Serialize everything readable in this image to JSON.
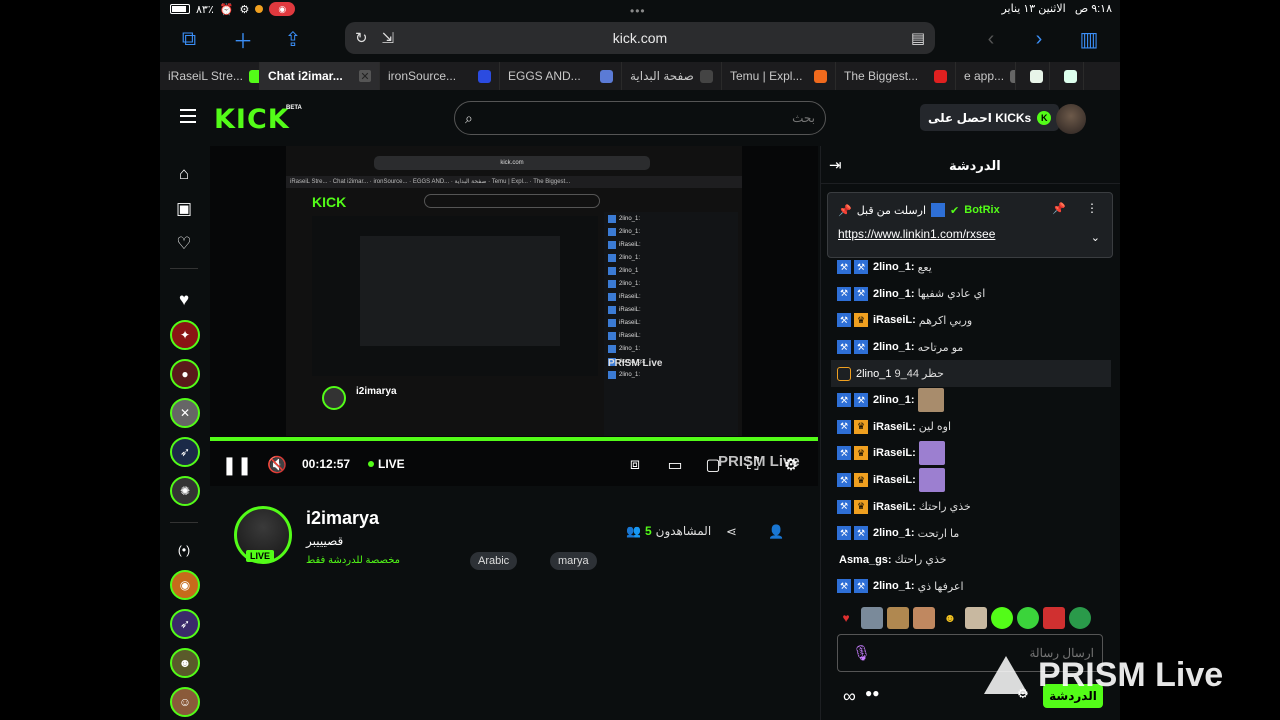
{
  "status_bar": {
    "time": "٩:١٨ ص",
    "date": "الاثنين ١٣ يناير",
    "battery_text": "٨٣٪"
  },
  "browser": {
    "url": "kick.com",
    "tabs": [
      {
        "label": "iRaseiL Stre...",
        "favicon_color": "#53fc18",
        "active": false
      },
      {
        "label": "Chat i2imar...",
        "favicon_color": "#555555",
        "active": true
      },
      {
        "label": "ironSource...",
        "favicon_color": "#2b4be0",
        "active": false
      },
      {
        "label": "EGGS AND...",
        "favicon_color": "#5b7bd6",
        "active": false
      },
      {
        "label": "صفحة البداية",
        "favicon_color": "#444444",
        "active": false
      },
      {
        "label": "Temu | Expl...",
        "favicon_color": "#f06a1d",
        "active": false
      },
      {
        "label": "The Biggest...",
        "favicon_color": "#e02020",
        "active": false
      },
      {
        "label": "e app...",
        "favicon_color": "#666666",
        "active": false
      }
    ]
  },
  "kick": {
    "logo": "KICK",
    "beta": "BETA",
    "search_placeholder": "بحث",
    "get_kicks": "احصل على KICKs"
  },
  "player": {
    "time": "00:12:57",
    "live": "LIVE",
    "watermark": "PRISM Live",
    "progress_fraction": 1.0
  },
  "channel": {
    "name": "i2imarya",
    "live_badge": "LIVE",
    "title": "قصيييبر",
    "category": "مخصصة للدردشة فقط",
    "tags": [
      "Arabic",
      "marya"
    ],
    "viewers_label": "المشاهدون",
    "viewers_count": "5"
  },
  "chat": {
    "title": "الدردشة",
    "pinned": {
      "by_label": "ارسلت من قبل",
      "user": "BotRix",
      "link": "https://www.linkin1.com/rxsee"
    },
    "messages": [
      {
        "user": "2lino_1:",
        "text": "يعع",
        "badges": 2,
        "crown": false,
        "highlight": false
      },
      {
        "user": "2lino_1:",
        "text": "اي عادي شفيها",
        "badges": 2,
        "crown": false,
        "highlight": false
      },
      {
        "user": "iRaseiL:",
        "text": "وربي اكرهم",
        "badges": 2,
        "crown": true,
        "highlight": false
      },
      {
        "user": "2lino_1:",
        "text": "مو مرتاحه",
        "badges": 2,
        "crown": false,
        "highlight": false
      },
      {
        "user": "2lino_1",
        "text": "حظر 44_9",
        "badges": 0,
        "crown": false,
        "highlight": true
      },
      {
        "user": "2lino_1:",
        "text": "",
        "badges": 2,
        "crown": false,
        "highlight": false,
        "emote": "#a88c6c"
      },
      {
        "user": "iRaseiL:",
        "text": "اوه لين",
        "badges": 2,
        "crown": true,
        "highlight": false
      },
      {
        "user": "iRaseiL:",
        "text": "",
        "badges": 2,
        "crown": true,
        "highlight": false,
        "emote": "#9c7fd0"
      },
      {
        "user": "iRaseiL:",
        "text": "",
        "badges": 2,
        "crown": true,
        "highlight": false,
        "emote": "#9c7fd0"
      },
      {
        "user": "iRaseiL:",
        "text": "خذي راحتك",
        "badges": 2,
        "crown": true,
        "highlight": false
      },
      {
        "user": "2lino_1:",
        "text": "ما ارتحت",
        "badges": 2,
        "crown": false,
        "highlight": false
      },
      {
        "user": "Asma_gs:",
        "text": "خذي راحتك",
        "badges": 0,
        "crown": false,
        "highlight": false
      },
      {
        "user": "2lino_1:",
        "text": "اعرفها ذي",
        "badges": 2,
        "crown": false,
        "highlight": false
      }
    ],
    "input_placeholder": "ارسال رسالة",
    "send_label": "الدردشة"
  },
  "colors": {
    "kick_green": "#53fc18",
    "bg": "#0b0e0f",
    "ios_blue": "#3b8ef6"
  },
  "watermark": "PRISM Live"
}
